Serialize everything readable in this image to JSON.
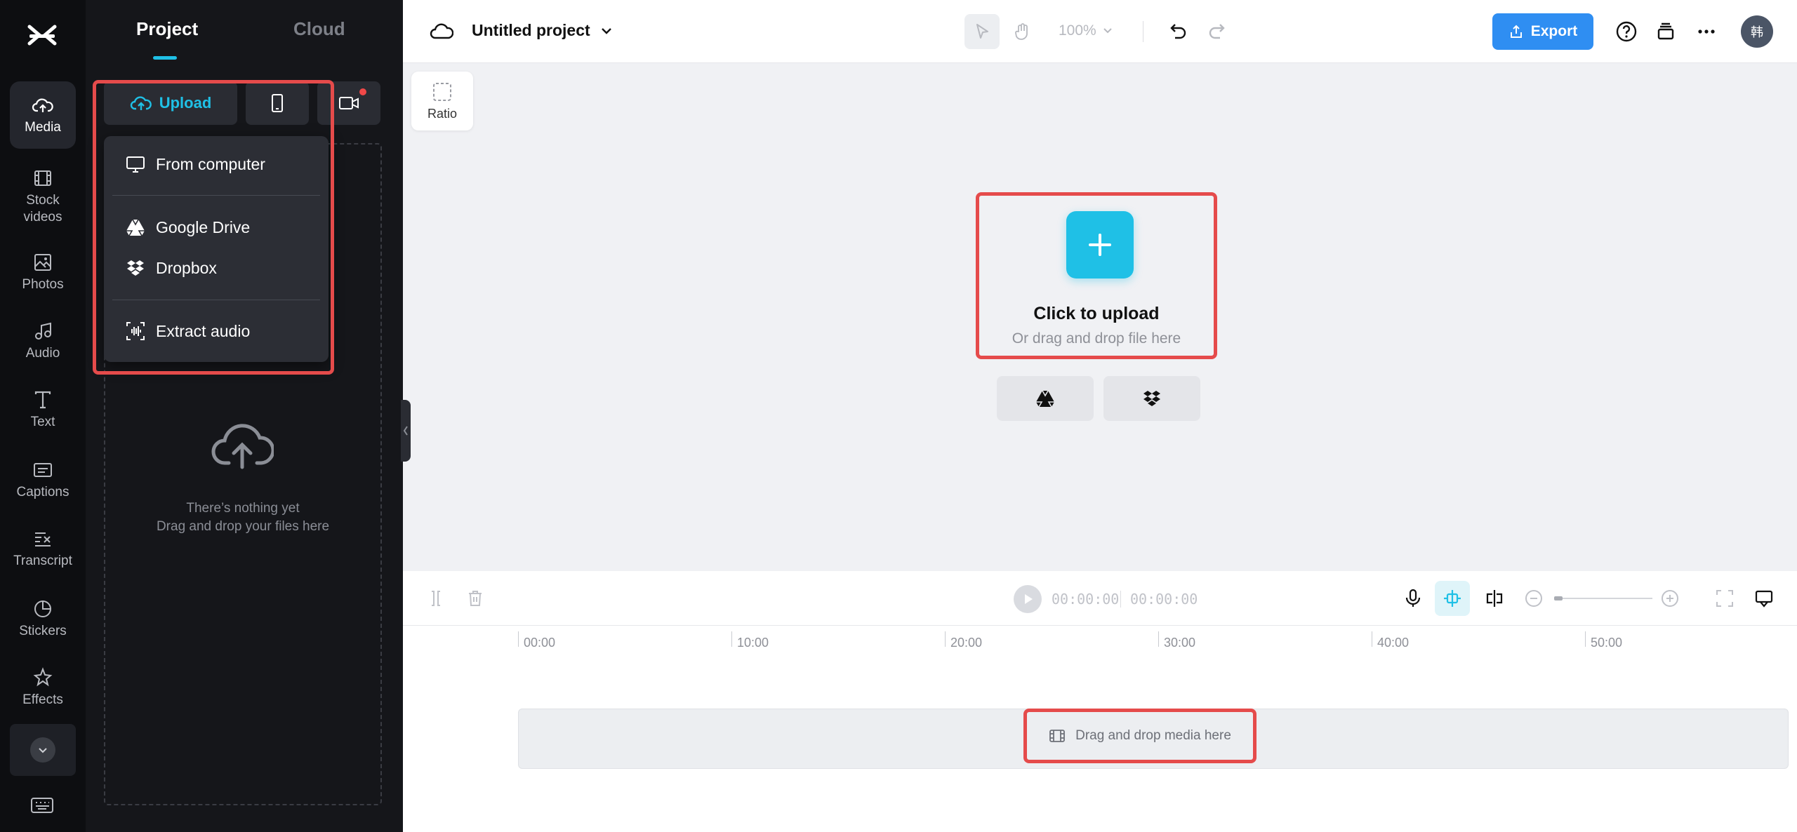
{
  "rail": {
    "items": [
      {
        "label": "Media",
        "icon": "cloud-upload-icon"
      },
      {
        "label": "Stock videos",
        "icon": "film-icon"
      },
      {
        "label": "Photos",
        "icon": "image-icon"
      },
      {
        "label": "Audio",
        "icon": "music-note-icon"
      },
      {
        "label": "Text",
        "icon": "text-icon"
      },
      {
        "label": "Captions",
        "icon": "captions-icon"
      },
      {
        "label": "Transcript",
        "icon": "transcript-icon"
      },
      {
        "label": "Stickers",
        "icon": "sticker-icon"
      },
      {
        "label": "Effects",
        "icon": "effects-icon"
      }
    ]
  },
  "panel": {
    "tabs": [
      {
        "label": "Project"
      },
      {
        "label": "Cloud"
      }
    ],
    "upload_label": "Upload",
    "dropdown": {
      "from_computer": "From computer",
      "google_drive": "Google Drive",
      "dropbox": "Dropbox",
      "extract_audio": "Extract audio"
    },
    "empty_line1": "There’s nothing yet",
    "empty_line2": "Drag and drop your files here"
  },
  "topbar": {
    "project_title": "Untitled project",
    "zoom": "100%",
    "export_label": "Export",
    "avatar_text": "韩"
  },
  "canvas": {
    "ratio_label": "Ratio",
    "click_to_upload": "Click to upload",
    "drag_drop_hint": "Or drag and drop file here"
  },
  "timeline": {
    "current_time": "00:00:00",
    "total_time": "00:00:00",
    "ruler": [
      "00:00",
      "10:00",
      "20:00",
      "30:00",
      "40:00",
      "50:00"
    ],
    "drop_hint": "Drag and drop media here"
  },
  "colors": {
    "accent": "#1fc0e6",
    "export": "#2f8ef2",
    "highlight": "#e54b4b",
    "sidebar_bg": "#0d0e11",
    "panel_bg": "#15161a"
  }
}
